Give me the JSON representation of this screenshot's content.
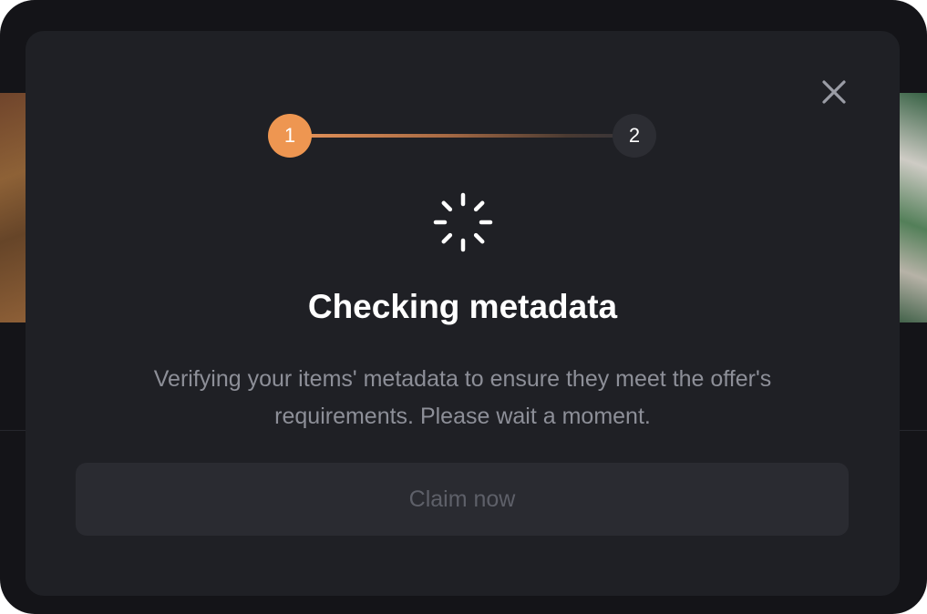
{
  "modal": {
    "close_icon": "close-icon",
    "steps": [
      {
        "number": "1",
        "state": "active",
        "color": "#ee9651"
      },
      {
        "number": "2",
        "state": "pending",
        "color": "#2c2d33"
      }
    ],
    "spinner_icon": "loading-spinner-icon",
    "title": "Checking metadata",
    "description": "Verifying your items' metadata to ensure they meet the offer's requirements. Please wait a moment.",
    "claim_button": {
      "label": "Claim now",
      "disabled": true
    }
  },
  "colors": {
    "background": "#141418",
    "modal_bg": "#1f2025",
    "accent": "#ee9651",
    "muted_text": "#8d8f98",
    "disabled_button_bg": "#2a2b31",
    "disabled_button_text": "#5e6069"
  }
}
